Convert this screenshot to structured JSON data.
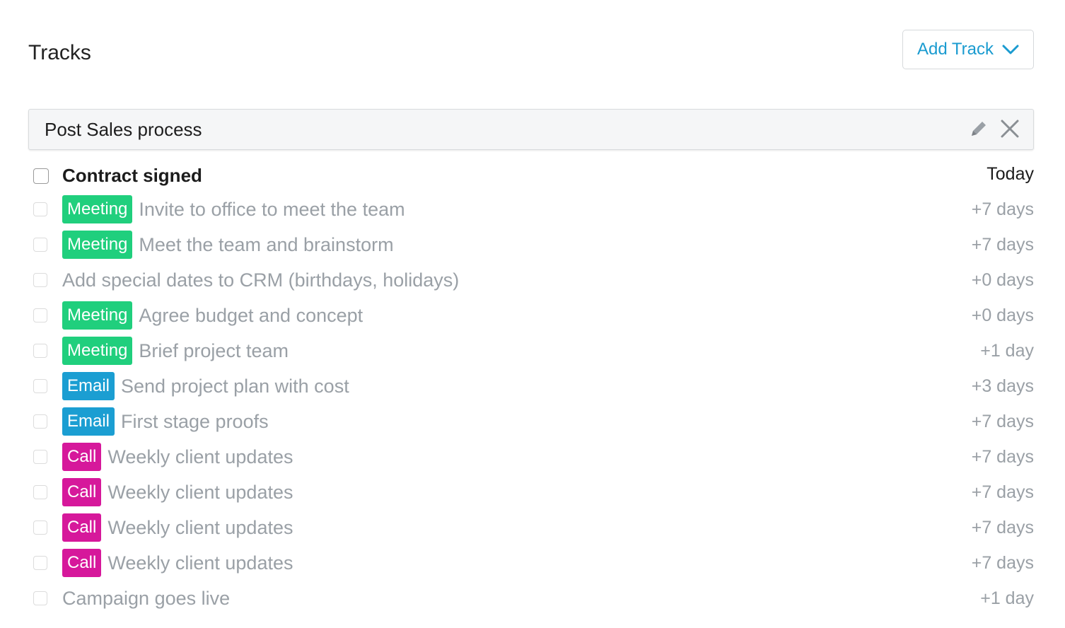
{
  "header": {
    "title": "Tracks",
    "add_track_label": "Add Track"
  },
  "colors": {
    "accent": "#1a9bd0",
    "meeting": "#20cf7d",
    "email": "#1b9ed2",
    "call": "#d6189b"
  },
  "track": {
    "name": "Post Sales process",
    "tasks": [
      {
        "type": "",
        "title": "Contract signed",
        "offset": "Today"
      },
      {
        "type": "Meeting",
        "title": "Invite to office to meet the team",
        "offset": "+7 days"
      },
      {
        "type": "Meeting",
        "title": "Meet the team and brainstorm",
        "offset": "+7 days"
      },
      {
        "type": "",
        "title": "Add special dates to CRM (birthdays, holidays)",
        "offset": "+0 days"
      },
      {
        "type": "Meeting",
        "title": "Agree budget and concept",
        "offset": "+0 days"
      },
      {
        "type": "Meeting",
        "title": "Brief project team",
        "offset": "+1 day"
      },
      {
        "type": "Email",
        "title": "Send project plan with cost",
        "offset": "+3 days"
      },
      {
        "type": "Email",
        "title": "First stage proofs",
        "offset": "+7 days"
      },
      {
        "type": "Call",
        "title": "Weekly client updates",
        "offset": "+7 days"
      },
      {
        "type": "Call",
        "title": "Weekly client updates",
        "offset": "+7 days"
      },
      {
        "type": "Call",
        "title": "Weekly client updates",
        "offset": "+7 days"
      },
      {
        "type": "Call",
        "title": "Weekly client updates",
        "offset": "+7 days"
      },
      {
        "type": "",
        "title": "Campaign goes live",
        "offset": "+1 day"
      }
    ]
  },
  "icons": {
    "add_track": "chevron-down-icon",
    "edit": "pencil-icon",
    "remove": "close-icon"
  }
}
